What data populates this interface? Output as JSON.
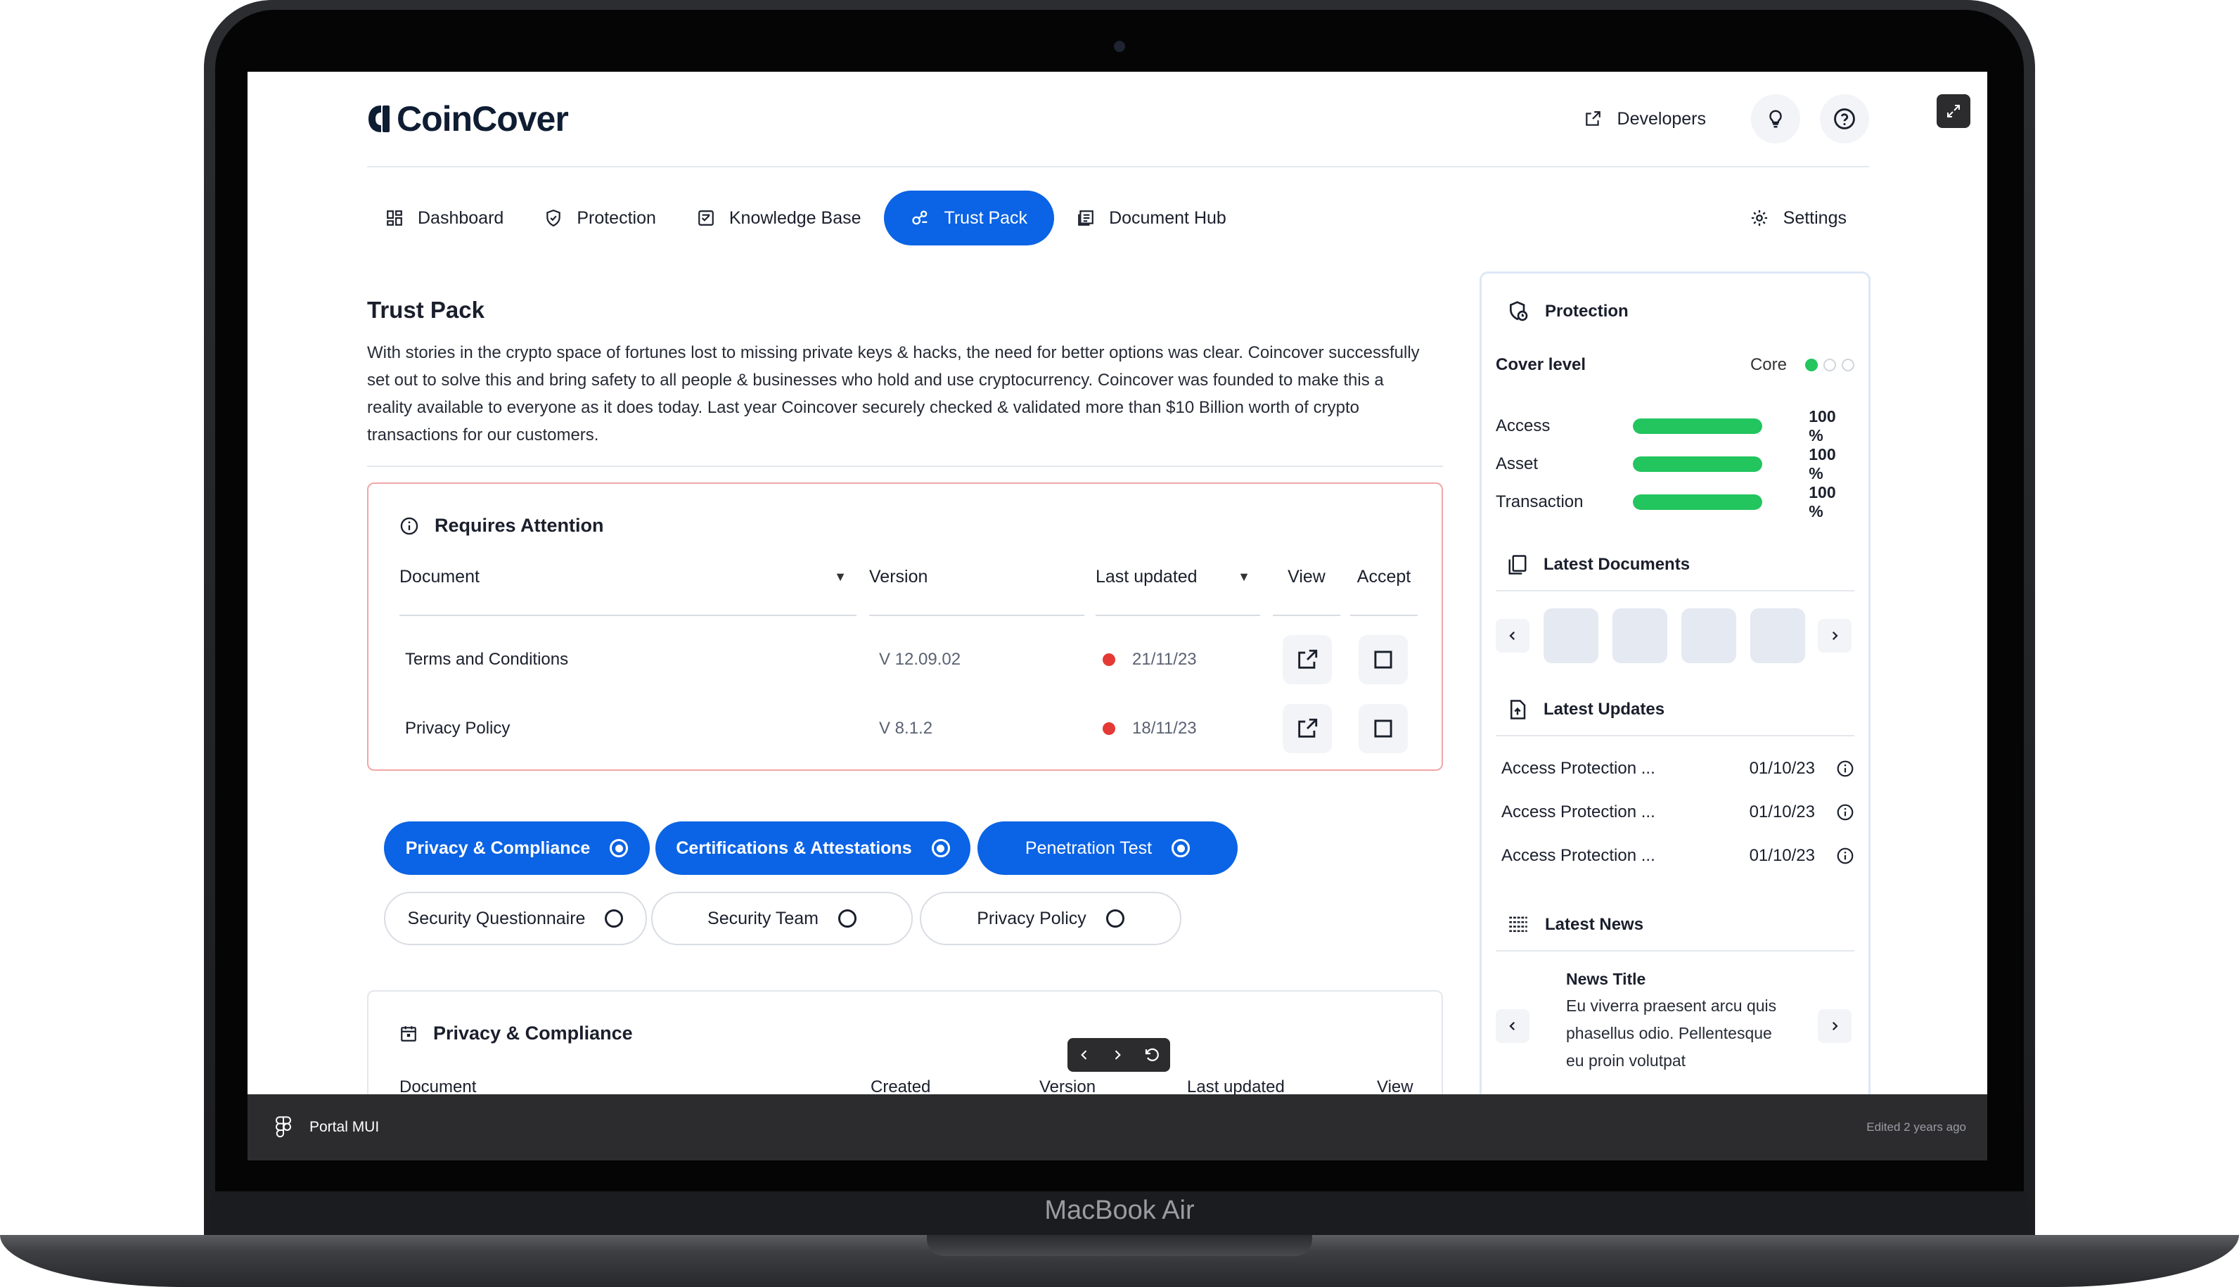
{
  "device": {
    "model": "MacBook Air"
  },
  "brand": {
    "name": "CoinCover",
    "accent": "#0b63e5",
    "success": "#22c55e",
    "danger": "#e53935"
  },
  "header": {
    "developers_label": "Developers",
    "developers_icon": "external-link-icon",
    "ideas_icon": "lightbulb-icon",
    "help_icon": "help-circle-icon"
  },
  "nav": {
    "items": [
      {
        "label": "Dashboard",
        "icon": "dashboard-icon"
      },
      {
        "label": "Protection",
        "icon": "shield-check-icon"
      },
      {
        "label": "Knowledge Base",
        "icon": "knowledge-icon"
      },
      {
        "label": "Trust Pack",
        "icon": "trust-icon",
        "active": true
      },
      {
        "label": "Document Hub",
        "icon": "document-hub-icon"
      }
    ],
    "settings_label": "Settings"
  },
  "page": {
    "title": "Trust Pack",
    "intro": "With stories in the crypto space of fortunes lost to missing private keys & hacks, the need for better options was clear. Coincover successfully set out to solve this and bring safety to all people & businesses who hold and use cryptocurrency. Coincover was founded to make this a reality available to everyone as it does today. Last year Coincover securely checked & validated more than $10 Billion worth of crypto transactions for our customers."
  },
  "attention": {
    "title": "Requires Attention",
    "columns": {
      "document": "Document",
      "version": "Version",
      "last_updated": "Last updated",
      "view": "View",
      "accept": "Accept"
    },
    "rows": [
      {
        "document": "Terms and Conditions",
        "version": "V 12.09.02",
        "last_updated": "21/11/23"
      },
      {
        "document": "Privacy Policy",
        "version": "V 8.1.2",
        "last_updated": "18/11/23"
      }
    ]
  },
  "filters": [
    {
      "label": "Privacy & Compliance",
      "selected": true
    },
    {
      "label": "Certifications & Attestations",
      "selected": true
    },
    {
      "label": "Penetration Test",
      "selected": true
    },
    {
      "label": "Security Questionnaire",
      "selected": false
    },
    {
      "label": "Security Team",
      "selected": false
    },
    {
      "label": "Privacy Policy",
      "selected": false
    }
  ],
  "privacy_section": {
    "title": "Privacy & Compliance",
    "columns": [
      "Document",
      "Created",
      "Version",
      "Last updated",
      "View"
    ]
  },
  "sidebar": {
    "protection": {
      "title": "Protection",
      "cover_level_label": "Cover level",
      "cover_level_value": "Core",
      "metrics": [
        {
          "label": "Access",
          "value": "100 %",
          "fraction": 1.0
        },
        {
          "label": "Asset",
          "value": "100 %",
          "fraction": 1.0
        },
        {
          "label": "Transaction",
          "value": "100 %",
          "fraction": 1.0
        }
      ]
    },
    "latest_documents": {
      "title": "Latest Documents"
    },
    "latest_updates": {
      "title": "Latest Updates",
      "items": [
        {
          "label": "Access Protection ...",
          "date": "01/10/23"
        },
        {
          "label": "Access Protection ...",
          "date": "01/10/23"
        },
        {
          "label": "Access Protection ...",
          "date": "01/10/23"
        }
      ]
    },
    "latest_news": {
      "title": "Latest News",
      "news_title": "News Title",
      "news_body": "Eu viverra praesent arcu quis phasellus odio. Pellentesque eu proin volutpat"
    }
  },
  "figma": {
    "file_name": "Portal MUI",
    "edited": "Edited 2 years ago"
  }
}
